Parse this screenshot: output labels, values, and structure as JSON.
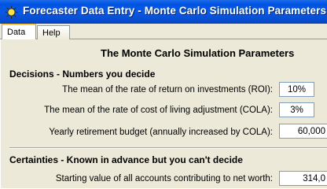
{
  "window": {
    "title": "Forecaster Data Entry - Monte Carlo Simulation Parameters",
    "icon": "sun-icon"
  },
  "tabs": [
    {
      "label": "Data",
      "active": true
    },
    {
      "label": "Help",
      "active": false
    }
  ],
  "main": {
    "heading": "The Monte Carlo Simulation Parameters",
    "decisions": {
      "title": "Decisions - Numbers you decide",
      "fields": [
        {
          "label": "The mean of the rate of return on investments (ROI):",
          "value": "10%"
        },
        {
          "label": "The mean of the rate of cost of living adjustment (COLA):",
          "value": "3%"
        },
        {
          "label": "Yearly retirement budget (annually increased by COLA):",
          "value": "60,000"
        }
      ]
    },
    "certainties": {
      "title": "Certainties - Known in advance but you can't decide",
      "fields": [
        {
          "label": "Starting value of all accounts contributing to net worth:",
          "value": "314,0"
        }
      ]
    }
  },
  "colors": {
    "titlebar": "#0054e3",
    "face": "#ece9d8",
    "field_border": "#7f9db9",
    "active_tab_accent": "#ffc83c"
  }
}
